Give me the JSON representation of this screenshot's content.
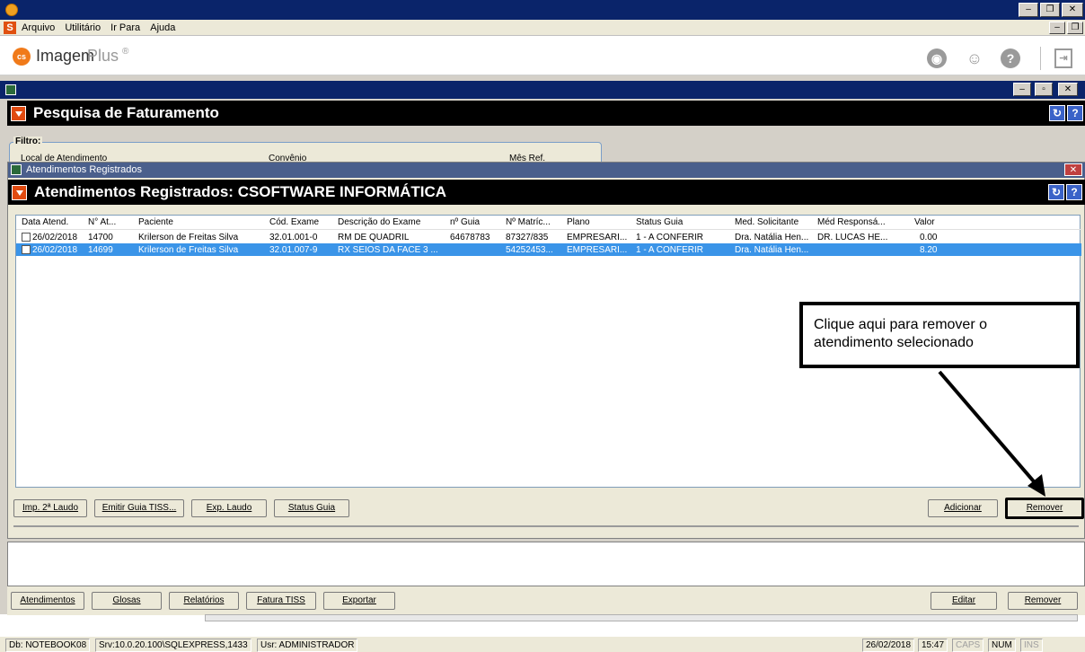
{
  "window": {
    "title": "",
    "minimize_icon": "minimize-icon",
    "restore_icon": "restore-icon",
    "close_icon": "close-icon"
  },
  "menu": {
    "items": [
      "Arquivo",
      "Utilitário",
      "Ir Para",
      "Ajuda"
    ]
  },
  "app": {
    "brand_main": "Imagem",
    "brand_sub": "Plus",
    "brand_mark": "®"
  },
  "pesquisa": {
    "header": "Pesquisa de Faturamento",
    "filter_label": "Filtro:",
    "filter_fields": [
      "Local de Atendimento",
      "Convênio",
      "Mês Ref."
    ]
  },
  "atendimentos": {
    "window_title": "Atendimentos Registrados",
    "header": "Atendimentos Registrados: CSOFTWARE INFORMÁTICA",
    "columns": [
      "Data Atend.",
      "N° At...",
      "Paciente",
      "Cód. Exame",
      "Descrição do Exame",
      "nº Guia",
      "Nº Matríc...",
      "Plano",
      "Status Guia",
      "Med. Solicitante",
      "Méd Responsá...",
      "Valor"
    ],
    "rows": [
      [
        "26/02/2018",
        "14700",
        "Krilerson de Freitas Silva",
        "32.01.001-0",
        "RM DE QUADRIL",
        "64678783",
        "87327/835",
        "EMPRESARI...",
        "1 - A CONFERIR",
        "Dra. Natália Hen...",
        "DR. LUCAS HE...",
        "0.00"
      ],
      [
        "26/02/2018",
        "14699",
        "Krilerson de Freitas Silva",
        "32.01.007-9",
        "RX SEIOS DA FACE 3 ...",
        "",
        "54252453...",
        "EMPRESARI...",
        "1 - A CONFERIR",
        "Dra. Natália Hen...",
        "",
        "8.20"
      ]
    ],
    "buttons": {
      "imp_laudo": "Imp. 2ª Laudo",
      "emitir_guia": "Emitir Guia TISS...",
      "exp_laudo": "Exp. Laudo",
      "status_guia": "Status Guia",
      "adicionar": "Adicionar",
      "remover": "Remover"
    }
  },
  "bottom_tabs": {
    "atendimentos": "Atendimentos",
    "glosas": "Glosas",
    "relatorios": "Relatórios",
    "fatura_tiss": "Fatura TISS",
    "exportar": "Exportar",
    "editar": "Editar",
    "remover": "Remover"
  },
  "callout": {
    "text_line1": "Clique aqui para remover o",
    "text_line2": "atendimento selecionado"
  },
  "status": {
    "db": "Db: NOTEBOOK08",
    "srv": "Srv:10.0.20.100\\SQLEXPRESS,1433",
    "usr": "Usr: ADMINISTRADOR",
    "date": "26/02/2018",
    "time": "15:47",
    "caps": "CAPS",
    "num": "NUM",
    "ins": "INS"
  },
  "colors": {
    "selected_row": "#3a94e8",
    "header_black": "#000000",
    "header_icon": "#e04a10"
  }
}
